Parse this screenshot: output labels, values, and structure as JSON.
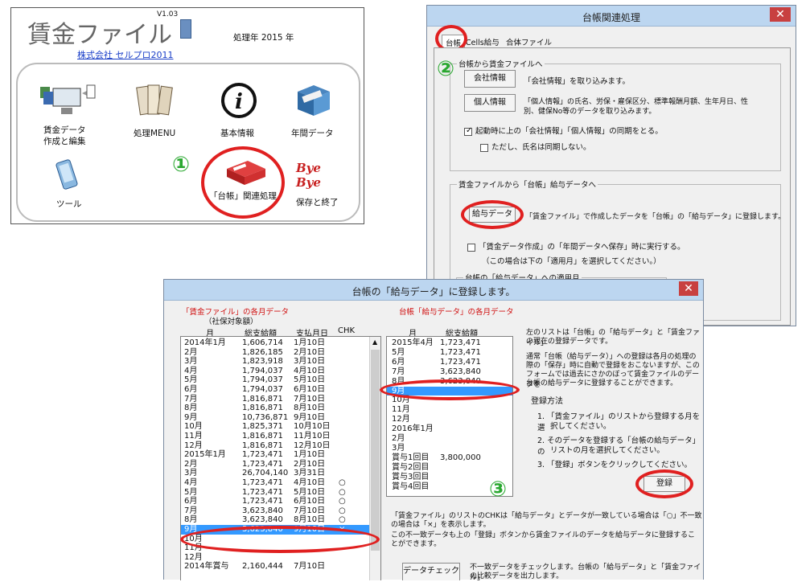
{
  "main_window": {
    "app_title": "賃金ファイル",
    "version": "V1.03",
    "year_label": "処理年 2015 年",
    "company_link": "株式会社 セルプロ2011",
    "menu": [
      {
        "label1": "賃金データ",
        "label2": "作成と編集",
        "icon": "computer-data-icon"
      },
      {
        "label1": "処理MENU",
        "label2": "",
        "icon": "books-icon"
      },
      {
        "label1": "基本情報",
        "label2": "",
        "icon": "info-icon"
      },
      {
        "label1": "年間データ",
        "label2": "",
        "icon": "file-box-icon"
      },
      {
        "label1": "ツール",
        "label2": "",
        "icon": "phone-tool-icon"
      },
      {
        "label1": "「台帳」関連処理",
        "label2": "",
        "icon": "red-binder-icon"
      },
      {
        "label1": "保存と終了",
        "label2": "",
        "icon": "bye-bye-icon",
        "logo_text": "Bye Bye"
      }
    ]
  },
  "annotations": {
    "step1": "①",
    "step2": "②",
    "step3": "③"
  },
  "ledger_dialog": {
    "title": "台帳関連処理",
    "close": "✕",
    "tabs": [
      "台帳",
      "Cells給与",
      "合体ファイル"
    ],
    "group1_label": "台帳から賃金ファイルへ",
    "company_button": "会社情報",
    "company_desc": "「会社情報」を取り込みます。",
    "personal_button": "個人情報",
    "personal_desc1": "「個人情報」の氏名、労保・雇保区分、標準報酬月額、生年月日、性",
    "personal_desc2": "別、健保No等のデータを取り込みます。",
    "sync_check": "起動時に上の「会社情報」「個人情報」の同期をとる。",
    "sync_sub_check": "ただし、氏名は同期しない。",
    "group2_label": "賃金ファイルから「台帳」給与データへ",
    "salary_button": "給与データ",
    "salary_desc": "「賃金ファイル」で作成したデータを「台帳」の「給与データ」に登録します。",
    "auto_check": "「賃金データ作成」の「年間データへ保存」時に実行する。",
    "auto_note": "（この場合は下の「適用月」を選択してください。）",
    "group3_label": "台帳の「給与データ」への適用月"
  },
  "register_dialog": {
    "title": "台帳の「給与データ」に登録します。",
    "close": "✕",
    "left_title": "「賃金ファイル」の各月データ",
    "left_subtitle": "（社保対象額）",
    "left_headers": [
      "月",
      "総支給額",
      "支払月日",
      "CHK"
    ],
    "left_rows": [
      {
        "m": "2014年1月",
        "amt": "1,606,714",
        "date": "1月10日",
        "chk": ""
      },
      {
        "m": "2月",
        "amt": "1,826,185",
        "date": "2月10日",
        "chk": ""
      },
      {
        "m": "3月",
        "amt": "1,823,918",
        "date": "3月10日",
        "chk": ""
      },
      {
        "m": "4月",
        "amt": "1,794,037",
        "date": "4月10日",
        "chk": ""
      },
      {
        "m": "5月",
        "amt": "1,794,037",
        "date": "5月10日",
        "chk": ""
      },
      {
        "m": "6月",
        "amt": "1,794,037",
        "date": "6月10日",
        "chk": ""
      },
      {
        "m": "7月",
        "amt": "1,816,871",
        "date": "7月10日",
        "chk": ""
      },
      {
        "m": "8月",
        "amt": "1,816,871",
        "date": "8月10日",
        "chk": ""
      },
      {
        "m": "9月",
        "amt": "10,736,871",
        "date": "9月10日",
        "chk": ""
      },
      {
        "m": "10月",
        "amt": "1,825,371",
        "date": "10月10日",
        "chk": ""
      },
      {
        "m": "11月",
        "amt": "1,816,871",
        "date": "11月10日",
        "chk": ""
      },
      {
        "m": "12月",
        "amt": "1,816,871",
        "date": "12月10日",
        "chk": ""
      },
      {
        "m": "2015年1月",
        "amt": "1,723,471",
        "date": "1月10日",
        "chk": ""
      },
      {
        "m": "2月",
        "amt": "1,723,471",
        "date": "2月10日",
        "chk": ""
      },
      {
        "m": "3月",
        "amt": "26,704,140",
        "date": "3月31日",
        "chk": ""
      },
      {
        "m": "4月",
        "amt": "1,723,471",
        "date": "4月10日",
        "chk": "○"
      },
      {
        "m": "5月",
        "amt": "1,723,471",
        "date": "5月10日",
        "chk": "○"
      },
      {
        "m": "6月",
        "amt": "1,723,471",
        "date": "6月10日",
        "chk": "○"
      },
      {
        "m": "7月",
        "amt": "3,623,840",
        "date": "7月10日",
        "chk": "○"
      },
      {
        "m": "8月",
        "amt": "3,623,840",
        "date": "8月10日",
        "chk": "○"
      },
      {
        "m": "9月",
        "amt": "3,623,840",
        "date": "9月10日",
        "chk": "×",
        "selected": true
      },
      {
        "m": "10月",
        "amt": "",
        "date": "",
        "chk": ""
      },
      {
        "m": "11月",
        "amt": "",
        "date": "",
        "chk": ""
      },
      {
        "m": "12月",
        "amt": "",
        "date": "",
        "chk": ""
      },
      {
        "m": "2014年賞与",
        "amt": "2,160,444",
        "date": "7月10日",
        "chk": ""
      }
    ],
    "right_title": "台帳「給与データ」の各月データ",
    "right_headers": [
      "月",
      "総支給額"
    ],
    "right_rows": [
      {
        "m": "2015年4月",
        "amt": "1,723,471"
      },
      {
        "m": "5月",
        "amt": "1,723,471"
      },
      {
        "m": "6月",
        "amt": "1,723,471"
      },
      {
        "m": "7月",
        "amt": "3,623,840"
      },
      {
        "m": "8月",
        "amt": "3,623,840"
      },
      {
        "m": "9月",
        "amt": "",
        "selected": true
      },
      {
        "m": "10月",
        "amt": ""
      },
      {
        "m": "11月",
        "amt": ""
      },
      {
        "m": "12月",
        "amt": ""
      },
      {
        "m": "2016年1月",
        "amt": ""
      },
      {
        "m": "2月",
        "amt": ""
      },
      {
        "m": "3月",
        "amt": ""
      },
      {
        "m": "賞与1回目",
        "amt": "3,800,000"
      },
      {
        "m": "賞与2回目",
        "amt": ""
      },
      {
        "m": "賞与3回目",
        "amt": ""
      },
      {
        "m": "賞与4回目",
        "amt": ""
      }
    ],
    "info1": "左のリストは「台帳」の「給与データ」と「賃金ファイル」",
    "info2": "の現在の登録データです。",
    "info3": "通常「台帳（給与データ）」への登録は各月の処理の",
    "info4": "際の「保存」時に自動で登録をおこないますが、この",
    "info5": "フォームでは過去にさかのぼって賃金ファイルのデータを",
    "info6": "台帳の給与データに登録することができます。",
    "method_title": "登録方法",
    "step1a": "1. 「賃金ファイル」のリストから登録する月を選",
    "step1b": "択してください。",
    "step2a": "2. そのデータを登録する「台帳の給与データ」の",
    "step2b": "リストの月を選択してください。",
    "step3a": "3. 「登録」ボタンをクリックしてください。",
    "register_button": "登録",
    "note1": "「賃金ファイル」のリストのCHKは「給与データ」とデータが一致している場合は「○」不一致",
    "note2": "の場合は「×」を表示します。",
    "note3": "この不一致データも上の「登録」ボタンから賃金ファイルのデータを給与データに登録するこ",
    "note4": "とができます。",
    "check_button": "データチェック",
    "check_desc1": "不一致データをチェックします。台帳の「給与データ」と「賃金ファイル」",
    "check_desc2": "の比較データを出力します。"
  }
}
